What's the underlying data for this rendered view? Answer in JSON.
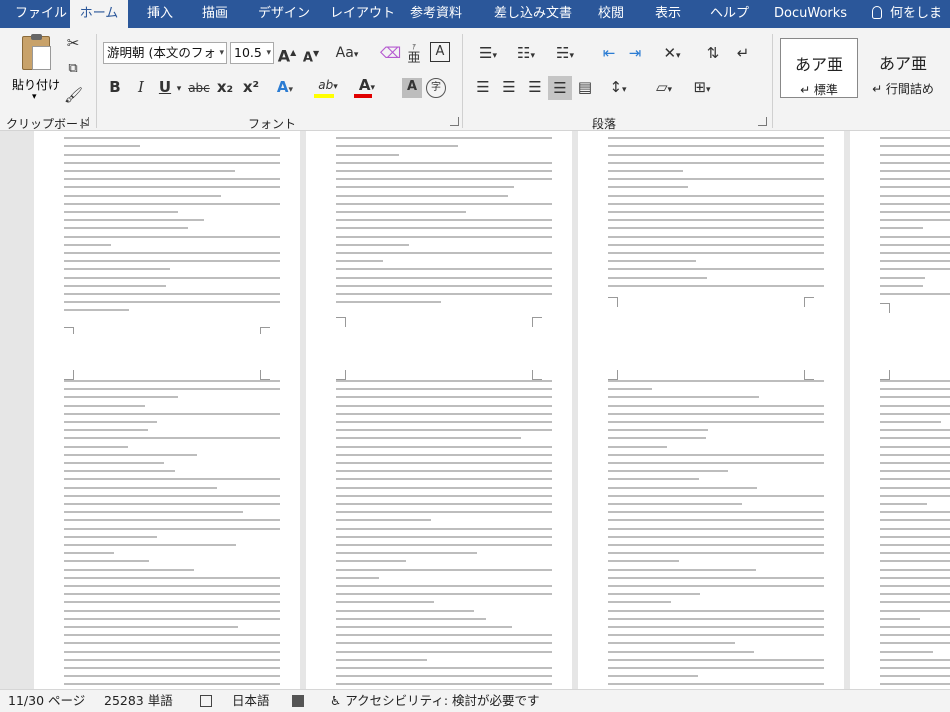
{
  "tabs": [
    {
      "label": "ファイル",
      "active": false
    },
    {
      "label": "ホーム",
      "active": true
    },
    {
      "label": "挿入",
      "active": false
    },
    {
      "label": "描画",
      "active": false
    },
    {
      "label": "デザイン",
      "active": false
    },
    {
      "label": "レイアウト",
      "active": false
    },
    {
      "label": "参考資料",
      "active": false
    },
    {
      "label": "差し込み文書",
      "active": false
    },
    {
      "label": "校閲",
      "active": false
    },
    {
      "label": "表示",
      "active": false
    },
    {
      "label": "ヘルプ",
      "active": false
    },
    {
      "label": "DocuWorks",
      "active": false
    }
  ],
  "search": {
    "label": "何をしま"
  },
  "clipboard": {
    "paste_label": "貼り付け",
    "group_label": "クリップボード"
  },
  "font": {
    "font_name": "游明朝 (本文のフォ",
    "font_size": "10.5",
    "grow_label": "A",
    "shrink_label": "A",
    "case_label": "Aa",
    "bold": "B",
    "italic": "I",
    "underline": "U",
    "strike": "abc",
    "subscript": "x₂",
    "superscript": "x²",
    "text_effects": "A",
    "highlight": "ab",
    "font_color": "A",
    "char_shading": "A",
    "enclose": "字",
    "phonetic": "亜",
    "border": "A",
    "group_label": "フォント"
  },
  "paragraph": {
    "group_label": "段落"
  },
  "styles": {
    "items": [
      {
        "sample": "あア亜",
        "name": "↵ 標準"
      },
      {
        "sample": "あア亜",
        "name": "↵ 行間詰め"
      }
    ]
  },
  "status": {
    "page": "11/30 ページ",
    "words": "25283 単語",
    "language": "日本語",
    "accessibility": "アクセシビリティ: 検討が必要です"
  },
  "colors": {
    "accent": "#2b579a",
    "highlight": "#ffff00",
    "font_color": "#e00000"
  }
}
